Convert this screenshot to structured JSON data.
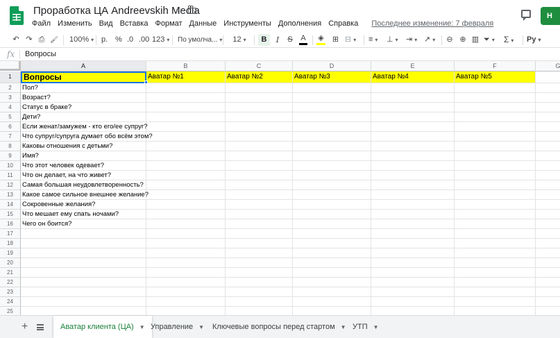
{
  "app": {
    "doc_title": "Проработка ЦА Andreevskih Media",
    "last_edit": "Последнее изменение: 7 февраля",
    "share_label": "Н",
    "menu": [
      "Файл",
      "Изменить",
      "Вид",
      "Вставка",
      "Формат",
      "Данные",
      "Инструменты",
      "Дополнения",
      "Справка"
    ]
  },
  "toolbar": {
    "undo": "↶",
    "redo": "↷",
    "print": "⎙",
    "paint_format": "🖌",
    "zoom": "100%",
    "currency": "р.",
    "percent": "%",
    "dec_decrease": ".0",
    "dec_increase": ".00",
    "more_formats": "123",
    "font": "По умолча...",
    "font_size": "12",
    "bold": "B",
    "italic": "I",
    "strike": "S",
    "text_color": "A",
    "fill": "◈",
    "borders": "⊞",
    "merge": "⊟",
    "halign": "≡",
    "valign": "⊥",
    "wrap": "⇥",
    "rotate": "↗",
    "link": "⊖",
    "comment": "⊕",
    "chart": "▥",
    "filter": "⏷",
    "functions": "Σ",
    "input_tools": "Ру"
  },
  "formula_bar": {
    "fx": "fx",
    "content": "Вопросы"
  },
  "columns": [
    "A",
    "B",
    "C",
    "D",
    "E",
    "F",
    "G"
  ],
  "header_row": [
    "Вопросы",
    "Аватар №1",
    "Аватар №2",
    "Аватар №3",
    "Аватар №4",
    "Аватар №5",
    ""
  ],
  "questions": [
    "Пол?",
    "Возраст?",
    "Статус в браке?",
    "Дети?",
    "Если женат/замужем - кто его/ее супруг?",
    "Что супруг/супруга думает обо всём этом?",
    "Каковы отношения с детьми?",
    "Имя?",
    "Что этот человек одевает?",
    "Что он делает, на что живет?",
    "Самая большая неудовлетворенность?",
    "Какое самое сильное внешнее желание?",
    "Сокровенные желания?",
    "Что мешает ему спать ночами?",
    "Чего он боится?"
  ],
  "row_count": 25,
  "highlight_color": "#ffff00",
  "selection_color": "#1a73e8",
  "sheet_tabs": [
    {
      "label": "Аватар клиента (ЦА)",
      "active": true
    },
    {
      "label": "Управление",
      "active": false
    },
    {
      "label": "Ключевые вопросы перед стартом",
      "active": false
    },
    {
      "label": "УТП",
      "active": false
    }
  ]
}
